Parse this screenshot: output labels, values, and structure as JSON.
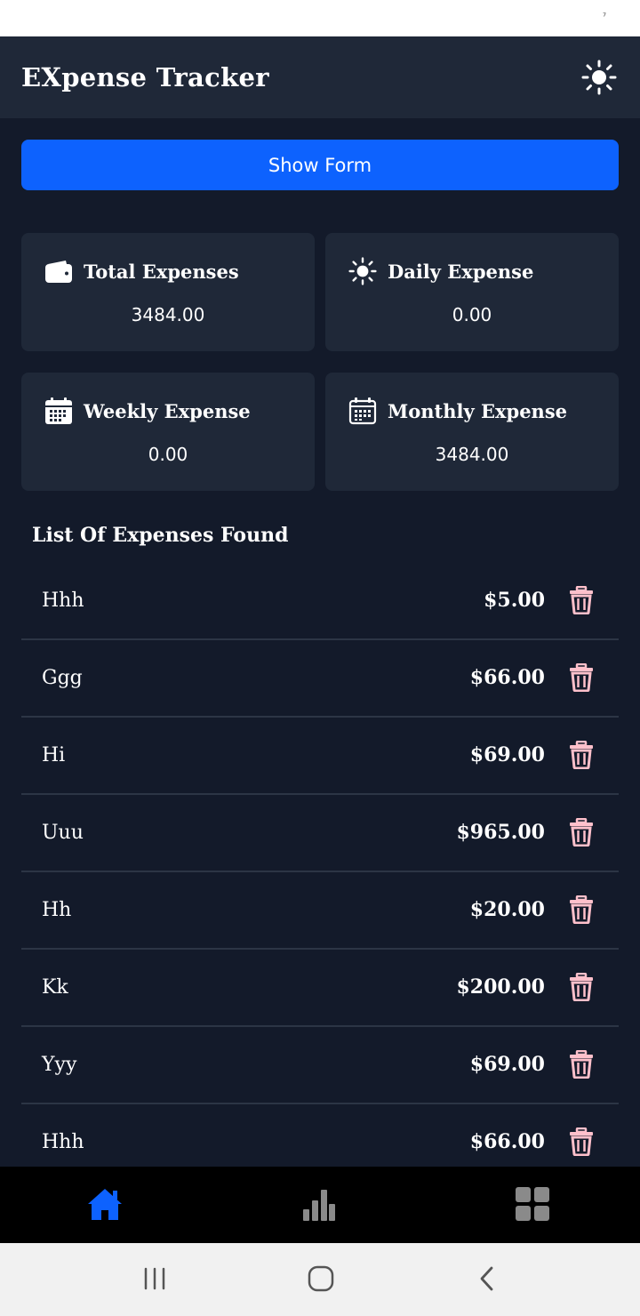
{
  "app": {
    "title": "EXpense Tracker",
    "theme_icon": "sun-icon"
  },
  "form_toggle": {
    "label": "Show Form"
  },
  "summary_cards": [
    {
      "title": "Total Expenses",
      "value": "3484.00",
      "icon": "wallet-icon"
    },
    {
      "title": "Daily Expense",
      "value": "0.00",
      "icon": "sun-icon"
    },
    {
      "title": "Weekly Expense",
      "value": "0.00",
      "icon": "calendar-filled-icon"
    },
    {
      "title": "Monthly Expense",
      "value": "3484.00",
      "icon": "calendar-outline-icon"
    }
  ],
  "list": {
    "heading": "List Of Expenses Found",
    "items": [
      {
        "name": "Hhh",
        "amount": "$5.00"
      },
      {
        "name": "Ggg",
        "amount": "$66.00"
      },
      {
        "name": "Hi",
        "amount": "$69.00"
      },
      {
        "name": "Uuu",
        "amount": "$965.00"
      },
      {
        "name": "Hh",
        "amount": "$20.00"
      },
      {
        "name": "Kk",
        "amount": "$200.00"
      },
      {
        "name": "Yyy",
        "amount": "$69.00"
      },
      {
        "name": "Hhh",
        "amount": "$66.00"
      }
    ]
  },
  "bottom_nav": {
    "items": [
      {
        "icon": "home-icon",
        "active": true
      },
      {
        "icon": "bar-chart-icon",
        "active": false
      },
      {
        "icon": "grid-icon",
        "active": false
      }
    ]
  },
  "colors": {
    "background": "#131a2a",
    "surface": "#1f2838",
    "accent": "#0d62fe",
    "delete": "#ffc0cb",
    "nav_inactive": "#8a8a8a"
  }
}
